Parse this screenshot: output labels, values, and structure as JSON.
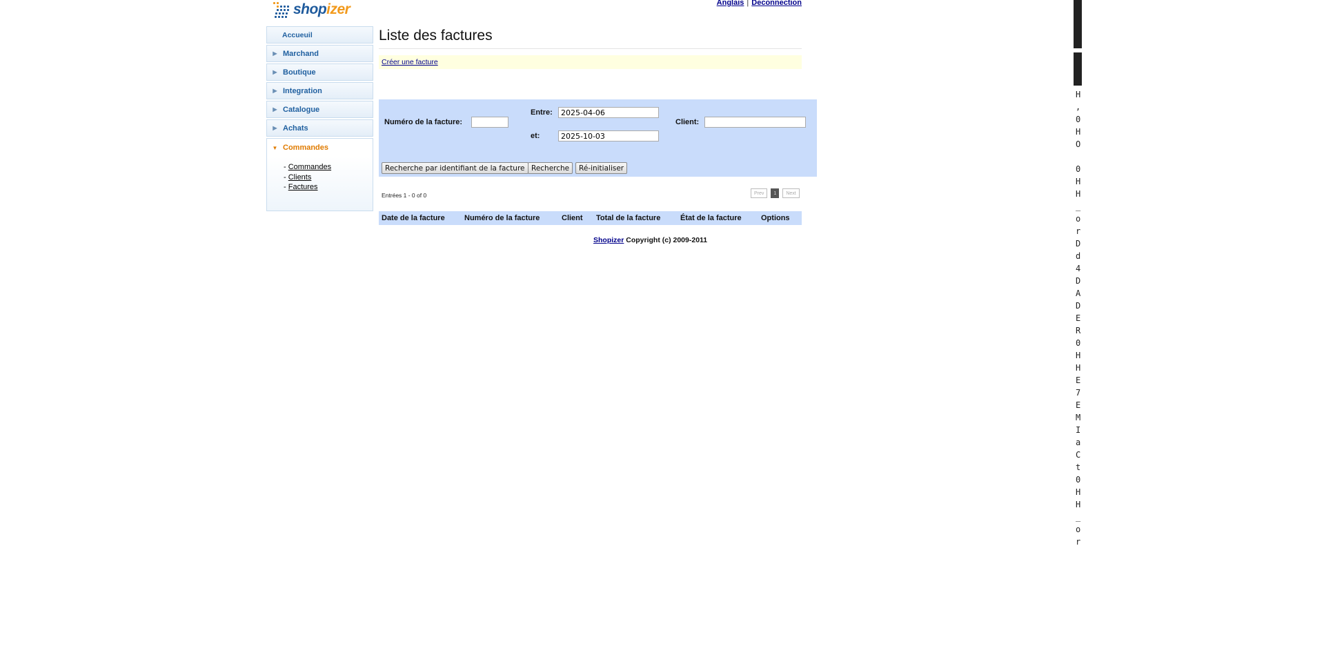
{
  "header": {
    "logo_text_1": "shop",
    "logo_text_2": "izer",
    "lang_link": "Anglais",
    "separator": "|",
    "logout_link": "Deconnection"
  },
  "sidebar": {
    "home": "Accueuil",
    "items": [
      {
        "label": "Marchand"
      },
      {
        "label": "Boutique"
      },
      {
        "label": "Integration"
      },
      {
        "label": "Catalogue"
      },
      {
        "label": "Achats"
      },
      {
        "label": "Commandes"
      }
    ],
    "submenu": [
      {
        "prefix": "- ",
        "label": "Commandes"
      },
      {
        "prefix": "- ",
        "label": "Clients"
      },
      {
        "prefix": "- ",
        "label": "Factures"
      }
    ]
  },
  "main": {
    "title": "Liste des factures",
    "create_link": "Créer une facture",
    "search": {
      "invoice_number_label": "Numéro de la facture:",
      "invoice_number_value": "",
      "between_label": "Entre:",
      "between_value": "2025-04-06",
      "and_label": "et:",
      "and_value": "2025-10-03",
      "client_label": "Client:",
      "client_value": "",
      "btn_search_by_id": "Recherche par identifiant de la facture",
      "btn_search": "Recherche",
      "btn_reset": "Ré-initialiser"
    },
    "entries_text": "Entrées 1 - 0 of 0",
    "pager": {
      "prev": "Prev",
      "current": "1",
      "next": "Next"
    },
    "table_headers": [
      "Date de la facture",
      "Numéro de la facture",
      "Client",
      "Total de la facture",
      "État de la facture",
      "Options"
    ]
  },
  "footer": {
    "link": "Shopizer",
    "text": " Copyright (c) 2009-2011"
  },
  "side_strip": {
    "chars": [
      "H",
      ",",
      "0",
      "H",
      "O",
      "",
      "0",
      "H",
      "H",
      "_",
      "o",
      "r",
      "D",
      "d",
      "4",
      "D",
      "A",
      "D",
      "E",
      "R",
      "0",
      "H",
      "H",
      "E",
      "7",
      "E",
      "M",
      "I",
      "a",
      "C",
      "t",
      "0",
      "H",
      "H",
      "_",
      "o",
      "r"
    ]
  },
  "colors": {
    "panel_blue": "#c9dcfb",
    "action_bar_yellow": "#ffffe0",
    "nav_blue": "#2060a0",
    "nav_active_orange": "#e07b00",
    "logo_blue": "#1e5a9c",
    "logo_orange": "#f29a1c"
  }
}
